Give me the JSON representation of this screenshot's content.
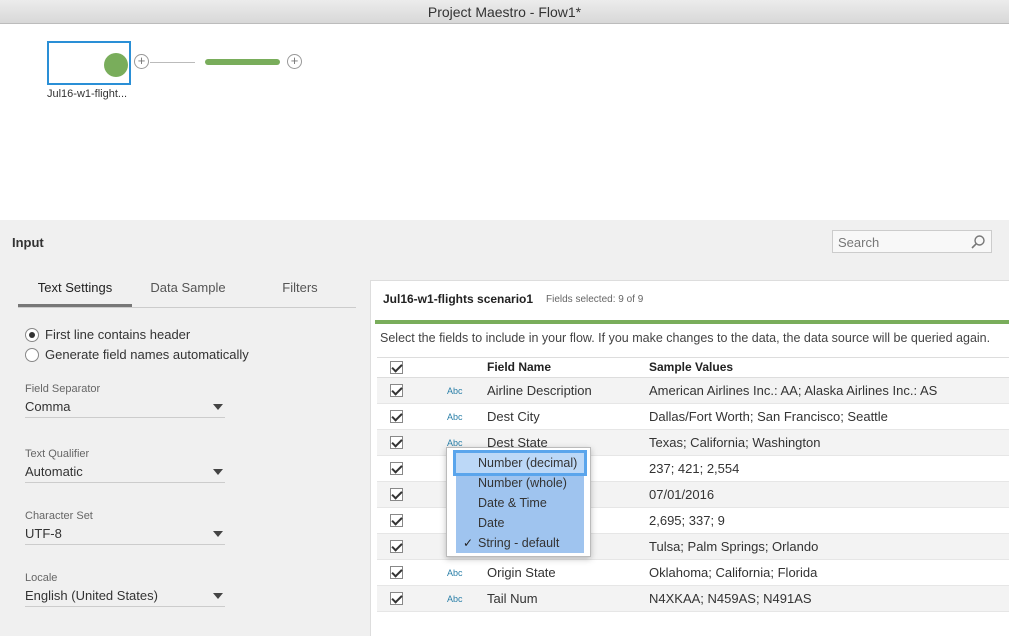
{
  "window": {
    "title": "Project Maestro - Flow1*"
  },
  "flow": {
    "node_label": "Jul16-w1-flight...",
    "plus_symbol": "+"
  },
  "panel": {
    "title": "Input",
    "search": {
      "placeholder": "Search"
    },
    "tabs": [
      {
        "label": "Text Settings",
        "active": true
      },
      {
        "label": "Data Sample",
        "active": false
      },
      {
        "label": "Filters",
        "active": false
      }
    ],
    "header_options": [
      {
        "label": "First line contains header",
        "selected": true
      },
      {
        "label": "Generate field names automatically",
        "selected": false
      }
    ],
    "settings": [
      {
        "label": "Field Separator",
        "value": "Comma"
      },
      {
        "label": "Text Qualifier",
        "value": "Automatic"
      },
      {
        "label": "Character Set",
        "value": "UTF-8"
      },
      {
        "label": "Locale",
        "value": "English (United States)"
      }
    ]
  },
  "main": {
    "title": "Jul16-w1-flights scenario1",
    "fields_selected": "Fields selected: 9 of 9",
    "description": "Select the fields to include in your flow. If you make changes to the data, the data source will be queried again.",
    "columns": {
      "field_name": "Field Name",
      "sample_values": "Sample Values"
    },
    "rows": [
      {
        "type": "Abc",
        "name": "Airline Description",
        "samples": "American Airlines Inc.: AA; Alaska Airlines Inc.: AS"
      },
      {
        "type": "Abc",
        "name": "Dest City",
        "samples": "Dallas/Fort Worth; San Francisco; Seattle"
      },
      {
        "type": "Abc",
        "name": "Dest State",
        "samples": "Texas; California; Washington"
      },
      {
        "type": "",
        "name": "",
        "samples": "237; 421; 2,554"
      },
      {
        "type": "",
        "name": "",
        "samples": "07/01/2016"
      },
      {
        "type": "",
        "name": "",
        "samples": "2,695; 337; 9"
      },
      {
        "type": "",
        "name": "",
        "samples": "Tulsa; Palm Springs; Orlando"
      },
      {
        "type": "Abc",
        "name": "Origin State",
        "samples": "Oklahoma; California; Florida"
      },
      {
        "type": "Abc",
        "name": "Tail Num",
        "samples": "N4XKAA; N459AS; N491AS"
      }
    ]
  },
  "type_menu": {
    "items": [
      {
        "label": "Number (decimal)",
        "checked": false,
        "highlighted": true
      },
      {
        "label": "Number (whole)",
        "checked": false,
        "highlighted": false
      },
      {
        "label": "Date & Time",
        "checked": false,
        "highlighted": false
      },
      {
        "label": "Date",
        "checked": false,
        "highlighted": false
      },
      {
        "label": "String - default",
        "checked": true,
        "highlighted": false
      }
    ],
    "check_mark": "✓"
  },
  "colors": {
    "accent_green": "#79ad5b",
    "selection_blue": "#2a8fd6",
    "menu_blue": "#9fc4ef"
  }
}
